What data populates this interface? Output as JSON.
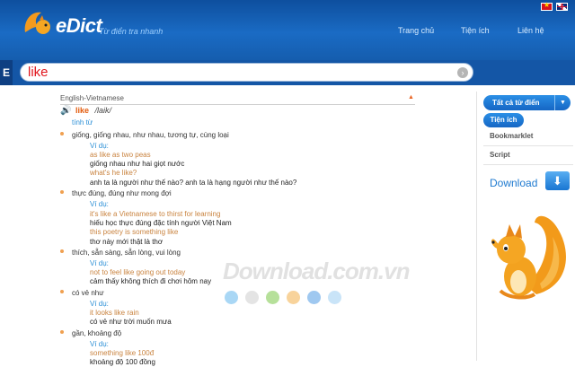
{
  "header": {
    "logo_text": "eDict",
    "tagline": "Từ điển tra nhanh",
    "nav": [
      "Trang chủ",
      "Tiện ích",
      "Liên hệ"
    ],
    "flags": [
      "vietnam-flag-icon",
      "uk-flag-icon"
    ]
  },
  "search": {
    "prefix": "E",
    "value": "like"
  },
  "entry": {
    "dictionary": "English-Vietnamese",
    "headword": "like",
    "phonetic": "/laik/",
    "part_of_speech": "tính từ",
    "senses": [
      {
        "meaning": "giống, giống nhau, như nhau, tương tự, cùng loại",
        "example_label": "Ví dụ:",
        "examples": [
          {
            "en": "as like as two peas",
            "vi": "giống nhau như hai giọt nước"
          },
          {
            "en": "what's he like?",
            "vi": "anh ta là người như thế nào? anh ta là hạng người như thế nào?"
          }
        ]
      },
      {
        "meaning": "thực đúng, đúng như mong đợi",
        "example_label": "Ví dụ:",
        "examples": [
          {
            "en": "it's like a Vietnamese to thirst for learning",
            "vi": "hiếu học thực đúng đặc tính người Việt Nam"
          },
          {
            "en": "this poetry is something like",
            "vi": "thơ này mới thật là thơ"
          }
        ]
      },
      {
        "meaning": "thích, sẵn sàng, sẵn lòng, vui lòng",
        "example_label": "Ví dụ:",
        "examples": [
          {
            "en": "not to feel like going out today",
            "vi": "cảm thấy không thích đi chơi hôm nay"
          }
        ]
      },
      {
        "meaning": "có vẻ như",
        "example_label": "Ví dụ:",
        "examples": [
          {
            "en": "it looks like rain",
            "vi": "có vẻ như trời muốn mưa"
          }
        ]
      },
      {
        "meaning": "gần, khoảng độ",
        "example_label": "Ví dụ:",
        "examples": [
          {
            "en": "something like 100đ",
            "vi": "khoảng độ 100 đồng"
          }
        ]
      }
    ]
  },
  "sidebar": {
    "all_dictionaries": "Tất cả từ điển",
    "utilities": "Tiện ích",
    "bookmarklet": "Bookmarklet",
    "script": "Script",
    "download": "Download"
  },
  "watermark": "Download.com.vn",
  "colors": {
    "header_blue": "#1a6bc4",
    "search_text": "#e1171e",
    "headword": "#e35b0d",
    "example_en": "#c9833f",
    "label_blue": "#2b8fd6"
  },
  "loader_dots": [
    "#a9d7f5",
    "#e4e4e4",
    "#b6e09a",
    "#f8d39b",
    "#9fc8f0",
    "#c9e4f8"
  ]
}
